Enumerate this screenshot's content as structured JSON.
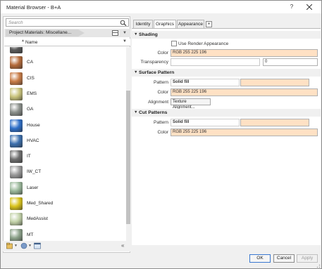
{
  "window": {
    "title": "Material Browser - B+A",
    "help_label": "?"
  },
  "left_panel": {
    "search_placeholder": "Search",
    "project_tab": "Project Materials: Miscellane...",
    "column_header": "Name",
    "materials": [
      {
        "label": "",
        "color": "#5b5b5b"
      },
      {
        "label": "CA",
        "color": "#b46a3a"
      },
      {
        "label": "CIS",
        "color": "#c87b45"
      },
      {
        "label": "EMS",
        "color": "#c8c27a"
      },
      {
        "label": "GA",
        "color": "#8a8f8a"
      },
      {
        "label": "House",
        "color": "#2d6ec8"
      },
      {
        "label": "HVAC",
        "color": "#3b6fae"
      },
      {
        "label": "IT",
        "color": "#6e6e6e"
      },
      {
        "label": "IW_CT",
        "color": "#9a9a9a"
      },
      {
        "label": "Laser",
        "color": "#9ab89a"
      },
      {
        "label": "Med_Shared",
        "color": "#d8c21a"
      },
      {
        "label": "MedAssist",
        "color": "#c2d2a8"
      },
      {
        "label": "MT",
        "color": "#8aa088"
      }
    ]
  },
  "tabs": [
    {
      "label": "Identity",
      "active": false
    },
    {
      "label": "Graphics",
      "active": true
    },
    {
      "label": "Appearance",
      "active": false
    }
  ],
  "tab_add_label": "+",
  "sections": {
    "shading": {
      "title": "Shading",
      "use_render_label": "Use Render Appearance",
      "color_label": "Color",
      "color_value": "RGB 255 225 196",
      "transparency_label": "Transparency",
      "transparency_value": "0"
    },
    "surface_pattern": {
      "title": "Surface Pattern",
      "pattern_label": "Pattern",
      "pattern_value": "Solid fill",
      "color_label": "Color",
      "color_value": "RGB 255 225 196",
      "alignment_label": "Alignment",
      "alignment_button": "Texture Alignment..."
    },
    "cut_pattern": {
      "title": "Cut Patterns",
      "pattern_label": "Pattern",
      "pattern_value": "Solid fill",
      "color_label": "Color",
      "color_value": "RGB 255 225 196"
    }
  },
  "buttons": {
    "ok": "OK",
    "cancel": "Cancel",
    "apply": "Apply"
  },
  "colors": {
    "peach": "#ffe1c4",
    "accent": "#3a78d0"
  }
}
